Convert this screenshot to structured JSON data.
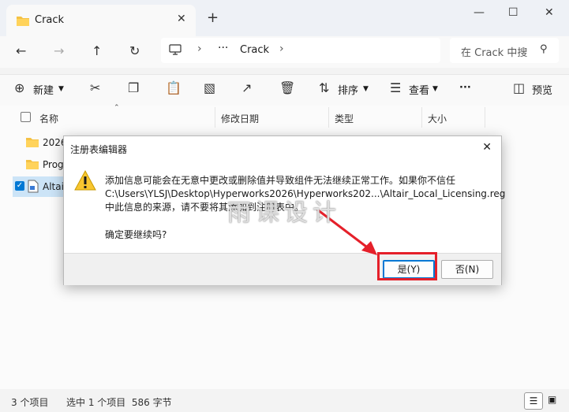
{
  "window": {
    "tab_title": "Crack",
    "close_tab": "✕",
    "new_tab": "+",
    "minimize": "—",
    "maximize": "☐",
    "close": "✕"
  },
  "address": {
    "crumb": "Crack",
    "dots": "···",
    "search_placeholder": "在 Crack 中搜"
  },
  "toolbar": {
    "new_label": "新建",
    "sort_label": "排序",
    "view_label": "查看",
    "more": "···",
    "preview_label": "预览"
  },
  "columns": {
    "name": "名称",
    "date": "修改日期",
    "type": "类型",
    "size": "大小"
  },
  "rows": [
    "2026",
    "Prog",
    "Altai"
  ],
  "status": {
    "count": "3 个项目",
    "selected": "选中 1 个项目  586 字节"
  },
  "dialog": {
    "title": "注册表编辑器",
    "line1": "添加信息可能会在无意中更改或删除值并导致组件无法继续正常工作。如果你不信任",
    "line2": "C:\\Users\\YLSJ\\Desktop\\Hyperworks2026\\Hyperworks202...\\Altair_Local_Licensing.reg",
    "line3": "中此信息的来源，请不要将其添加到注册表中。",
    "confirm": "确定要继续吗?",
    "yes": "是(Y)",
    "no": "否(N)"
  },
  "watermark": "雨课设计",
  "colors": {
    "accent": "#0078d4",
    "highlight": "#e5202a",
    "folder": "#f4c144"
  }
}
